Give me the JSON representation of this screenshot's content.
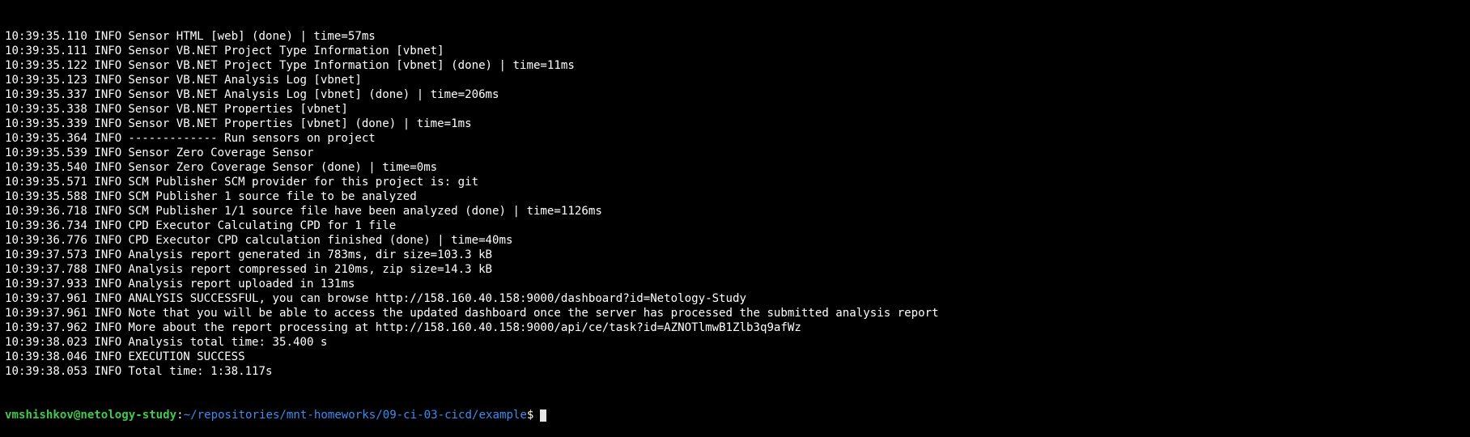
{
  "terminal": {
    "log_lines": [
      {
        "ts": "10:39:35.110",
        "level": "INFO",
        "msg": "Sensor HTML [web] (done) | time=57ms"
      },
      {
        "ts": "10:39:35.111",
        "level": "INFO",
        "msg": "Sensor VB.NET Project Type Information [vbnet]"
      },
      {
        "ts": "10:39:35.122",
        "level": "INFO",
        "msg": "Sensor VB.NET Project Type Information [vbnet] (done) | time=11ms"
      },
      {
        "ts": "10:39:35.123",
        "level": "INFO",
        "msg": "Sensor VB.NET Analysis Log [vbnet]"
      },
      {
        "ts": "10:39:35.337",
        "level": "INFO",
        "msg": "Sensor VB.NET Analysis Log [vbnet] (done) | time=206ms"
      },
      {
        "ts": "10:39:35.338",
        "level": "INFO",
        "msg": "Sensor VB.NET Properties [vbnet]"
      },
      {
        "ts": "10:39:35.339",
        "level": "INFO",
        "msg": "Sensor VB.NET Properties [vbnet] (done) | time=1ms"
      },
      {
        "ts": "10:39:35.364",
        "level": "INFO",
        "msg": "------------- Run sensors on project"
      },
      {
        "ts": "10:39:35.539",
        "level": "INFO",
        "msg": "Sensor Zero Coverage Sensor"
      },
      {
        "ts": "10:39:35.540",
        "level": "INFO",
        "msg": "Sensor Zero Coverage Sensor (done) | time=0ms"
      },
      {
        "ts": "10:39:35.571",
        "level": "INFO",
        "msg": "SCM Publisher SCM provider for this project is: git"
      },
      {
        "ts": "10:39:35.588",
        "level": "INFO",
        "msg": "SCM Publisher 1 source file to be analyzed"
      },
      {
        "ts": "10:39:36.718",
        "level": "INFO",
        "msg": "SCM Publisher 1/1 source file have been analyzed (done) | time=1126ms"
      },
      {
        "ts": "10:39:36.734",
        "level": "INFO",
        "msg": "CPD Executor Calculating CPD for 1 file"
      },
      {
        "ts": "10:39:36.776",
        "level": "INFO",
        "msg": "CPD Executor CPD calculation finished (done) | time=40ms"
      },
      {
        "ts": "10:39:37.573",
        "level": "INFO",
        "msg": "Analysis report generated in 783ms, dir size=103.3 kB"
      },
      {
        "ts": "10:39:37.788",
        "level": "INFO",
        "msg": "Analysis report compressed in 210ms, zip size=14.3 kB"
      },
      {
        "ts": "10:39:37.933",
        "level": "INFO",
        "msg": "Analysis report uploaded in 131ms"
      },
      {
        "ts": "10:39:37.961",
        "level": "INFO",
        "msg": "ANALYSIS SUCCESSFUL, you can browse http://158.160.40.158:9000/dashboard?id=Netology-Study"
      },
      {
        "ts": "10:39:37.961",
        "level": "INFO",
        "msg": "Note that you will be able to access the updated dashboard once the server has processed the submitted analysis report"
      },
      {
        "ts": "10:39:37.962",
        "level": "INFO",
        "msg": "More about the report processing at http://158.160.40.158:9000/api/ce/task?id=AZNOTlmwB1Zlb3q9afWz"
      },
      {
        "ts": "10:39:38.023",
        "level": "INFO",
        "msg": "Analysis total time: 35.400 s"
      },
      {
        "ts": "10:39:38.046",
        "level": "INFO",
        "msg": "EXECUTION SUCCESS"
      },
      {
        "ts": "10:39:38.053",
        "level": "INFO",
        "msg": "Total time: 1:38.117s"
      }
    ],
    "prompt": {
      "user_host": "vmshishkov@netology-study",
      "separator": ":",
      "path": "~/repositories/mnt-homeworks/09-ci-03-cicd/example",
      "symbol": "$"
    },
    "colors": {
      "background": "#000000",
      "text": "#ffffff",
      "user_host": "#3ecb4c",
      "path": "#3c8cf2",
      "cursor": "#e6e6e6"
    }
  }
}
